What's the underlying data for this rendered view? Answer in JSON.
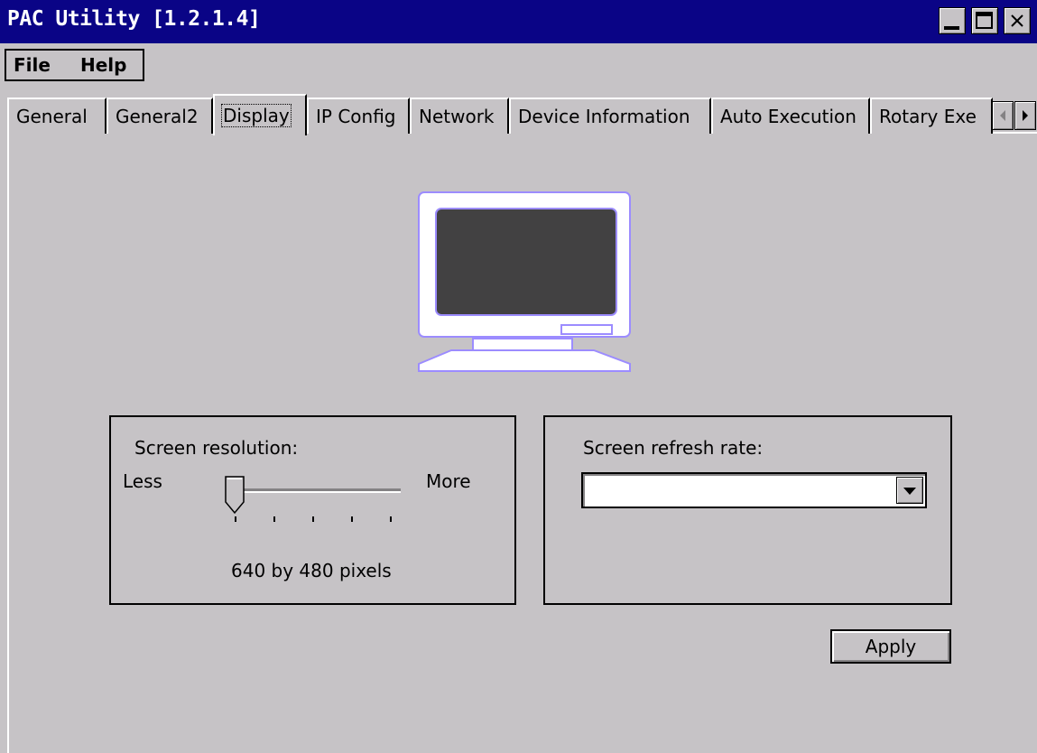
{
  "window": {
    "title": "PAC Utility  [1.2.1.4]"
  },
  "menu": {
    "file": "File",
    "help": "Help"
  },
  "tabs": [
    {
      "label": "General"
    },
    {
      "label": "General2"
    },
    {
      "label": "Display"
    },
    {
      "label": "IP Config"
    },
    {
      "label": "Network"
    },
    {
      "label": "Device Information"
    },
    {
      "label": "Auto Execution"
    },
    {
      "label": "Rotary Exe"
    }
  ],
  "active_tab": "Display",
  "display": {
    "resolution_label": "Screen resolution:",
    "less_label": "Less",
    "more_label": "More",
    "resolution_value": "640 by 480 pixels",
    "slider_position": 0,
    "refresh_label": "Screen refresh rate:",
    "refresh_value": "",
    "apply_label": "Apply"
  },
  "icons": [
    "minimize-icon",
    "maximize-icon",
    "close-icon",
    "monitor-icon",
    "tab-scroll-left-icon",
    "tab-scroll-right-icon",
    "dropdown-arrow-icon"
  ],
  "colors": {
    "titlebar": "#0a0486",
    "face": "#c6c3c6",
    "monitor_outline": "#9c8cff",
    "screen": "#424142"
  }
}
